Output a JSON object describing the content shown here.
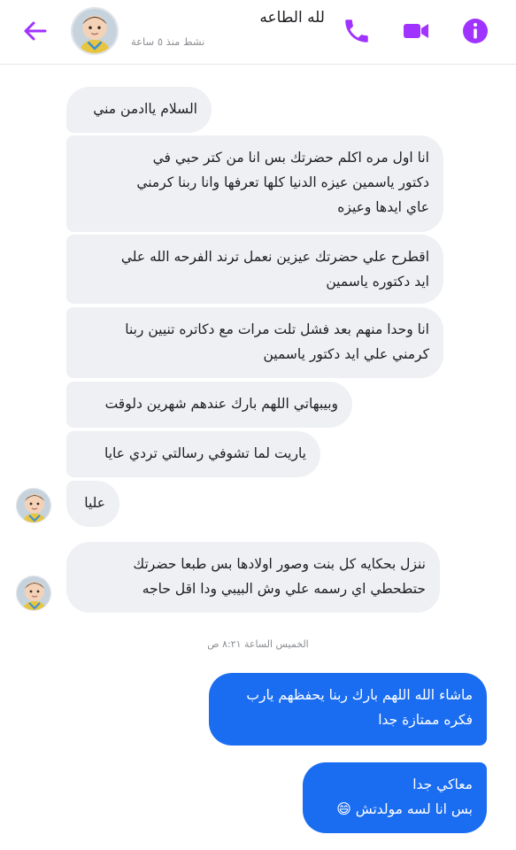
{
  "header": {
    "contact_name": "لله الطاعه",
    "active_status": "نشط منذ ٥ ساعة",
    "accent_color": "#a033ff",
    "icons": [
      "back-arrow-icon",
      "phone-icon",
      "video-camera-icon",
      "info-icon"
    ]
  },
  "messages": [
    {
      "id": "m1",
      "direction": "incoming",
      "lines": [
        "السلام ياادمن مني"
      ]
    },
    {
      "id": "m2",
      "direction": "incoming",
      "lines": [
        "انا اول مره اكلم حضرتك بس انا من كتر حبي في",
        "دكتور ياسمين عيزه الدنيا كلها تعرفها وانا ربنا كرمني",
        "عاي ايدها وعيزه"
      ]
    },
    {
      "id": "m3",
      "direction": "incoming",
      "lines": [
        "اقطرح علي حضرتك عيزين نعمل ترند الفرحه الله علي",
        "ايد دكتوره ياسمين"
      ]
    },
    {
      "id": "m4",
      "direction": "incoming",
      "lines": [
        "انا وحدا منهم بعد فشل تلت مرات مع دكاتره تنيين ربنا",
        "كرمني علي ايد دكتور ياسمين"
      ]
    },
    {
      "id": "m5",
      "direction": "incoming",
      "lines": [
        "وبيبهاتي اللهم بارك عندهم شهرين دلوقت"
      ]
    },
    {
      "id": "m6",
      "direction": "incoming",
      "lines": [
        "ياريت لما تشوفي رسالتي تردي عايا"
      ]
    },
    {
      "id": "m7",
      "direction": "incoming",
      "lines": [
        "عليا"
      ]
    },
    {
      "id": "m8",
      "direction": "incoming",
      "lines": [
        "ننزل بحكايه كل بنت وصور اولادها بس طبعا حضرتك",
        "حتطحطي اي رسمه علي وش البيبي ودا اقل حاجه"
      ]
    },
    {
      "id": "m9",
      "direction": "outgoing",
      "lines": [
        "ماشاء الله اللهم بارك ربنا يحفظهم يارب",
        "فكره ممتازة جدا"
      ]
    },
    {
      "id": "m10",
      "direction": "outgoing",
      "lines": [
        "معاكي جدا",
        "بس انا لسه مولدتش"
      ],
      "emoji": "😄"
    }
  ],
  "timestamp": "الخميس الساعة ٨:٢١ ص",
  "colors": {
    "incoming_bubble": "#eef0f3",
    "outgoing_bubble": "#1a6df1",
    "secondary_text": "#8a8d91"
  }
}
